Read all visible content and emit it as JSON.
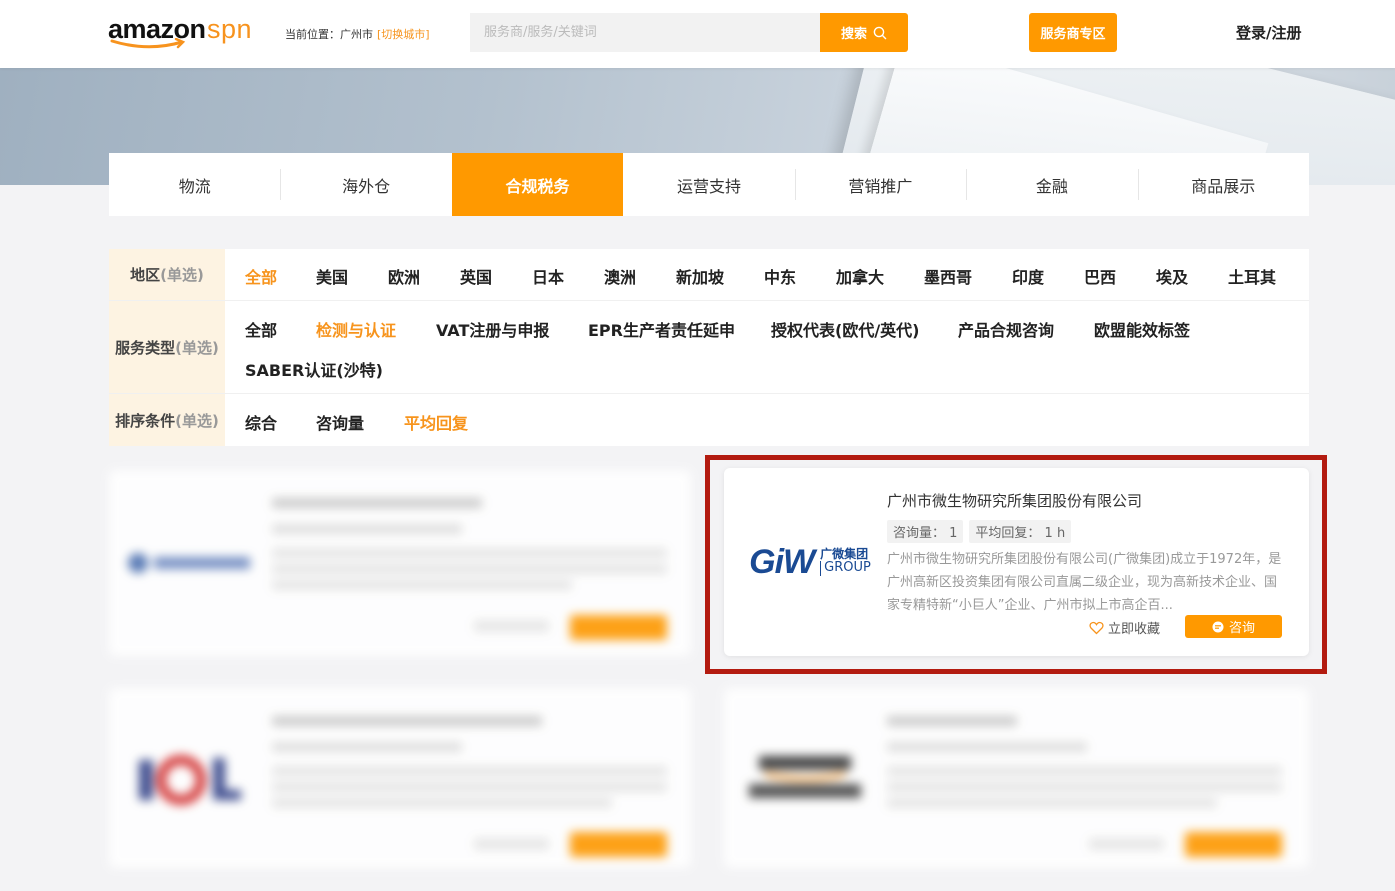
{
  "header": {
    "logo_word": "amazon",
    "logo_suffix": "spn",
    "location_label": "当前位置：广州市",
    "switch_city": "[切换城市]",
    "search_placeholder": "服务商/服务/关键词",
    "search_button": "搜索",
    "provider_zone": "服务商专区",
    "login": "登录/注册"
  },
  "category_tabs": [
    "物流",
    "海外仓",
    "合规税务",
    "运营支持",
    "营销推广",
    "金融",
    "商品展示"
  ],
  "active_category": "合规税务",
  "filters": {
    "region": {
      "label": "地区",
      "hint": "(单选)",
      "options": [
        "全部",
        "美国",
        "欧洲",
        "英国",
        "日本",
        "澳洲",
        "新加坡",
        "中东",
        "加拿大",
        "墨西哥",
        "印度",
        "巴西",
        "埃及",
        "土耳其"
      ],
      "selected": "全部"
    },
    "service_type": {
      "label": "服务类型",
      "hint": "(单选)",
      "options": [
        "全部",
        "检测与认证",
        "VAT注册与申报",
        "EPR生产者责任延申",
        "授权代表(欧代/英代)",
        "产品合规咨询",
        "欧盟能效标签",
        "SABER认证(沙特)"
      ],
      "selected": "检测与认证"
    },
    "sort": {
      "label": "排序条件",
      "hint": "(单选)",
      "options": [
        "综合",
        "咨询量",
        "平均回复"
      ],
      "selected": "平均回复"
    }
  },
  "featured_card": {
    "logo_text": "GiW",
    "logo_cn": "广微集团",
    "logo_en": "GROUP",
    "title": "广州市微生物研究所集团股份有限公司",
    "consult_count": "咨询量： 1",
    "avg_reply": "平均回复： 1 h",
    "description": "广州市微生物研究所集团股份有限公司(广微集团)成立于1972年，是广州高新区投资集团有限公司直属二级企业，现为高新技术企业、国家专精特新“小巨人”企业、广州市拟上市高企百...",
    "favorite": "立即收藏",
    "consult_button": "咨询"
  },
  "colors": {
    "accent": "#ff9900",
    "selected_text": "#f7941d",
    "highlight_border": "#b31b10",
    "filter_label_bg": "#fdf3e2"
  },
  "icons": [
    "search-icon",
    "heart-icon",
    "chat-icon"
  ]
}
